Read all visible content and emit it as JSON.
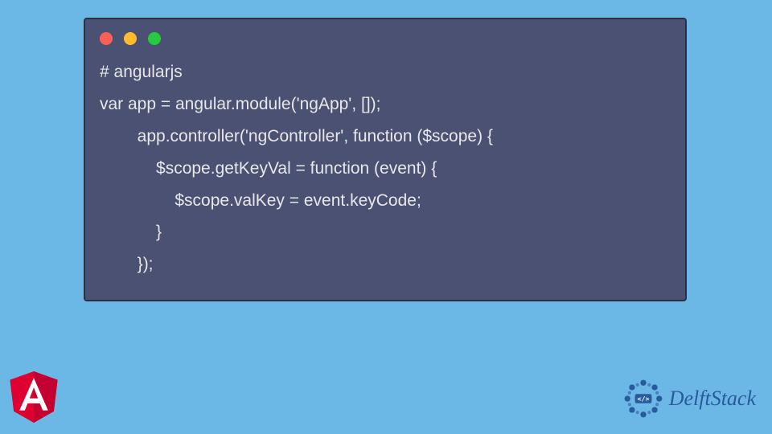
{
  "code": {
    "line1": "# angularjs",
    "line2": "var app = angular.module('ngApp', []);",
    "line3": "        app.controller('ngController', function ($scope) {",
    "line4": "            $scope.getKeyVal = function (event) {",
    "line5": "                $scope.valKey = event.keyCode;",
    "line6": "            }",
    "line7": "        });"
  },
  "logos": {
    "angular_letter": "A",
    "delftstack_text": "DelftStack",
    "delftstack_symbol": "</>"
  },
  "colors": {
    "page_bg": "#6bb8e6",
    "window_bg": "#4a5172",
    "code_text": "#e8e8e8",
    "angular_red": "#dd0031",
    "delftstack_blue": "#2a5a9e"
  }
}
